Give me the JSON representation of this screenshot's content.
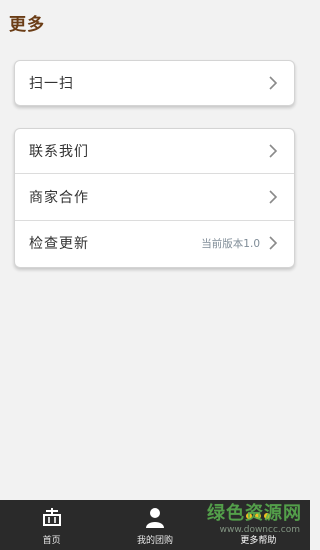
{
  "header": {
    "title": "更多"
  },
  "scan_card": {
    "label": "扫一扫"
  },
  "menu": {
    "items": [
      {
        "label": "联系我们"
      },
      {
        "label": "商家合作"
      },
      {
        "label": "检查更新",
        "value": "当前版本1.0"
      }
    ]
  },
  "tabbar": {
    "tabs": [
      {
        "label": "首页",
        "icon": "home-basket-icon"
      },
      {
        "label": "我的团购",
        "icon": "user-icon"
      },
      {
        "label": "更多帮助",
        "icon": "more-dots-icon",
        "active": true
      }
    ]
  },
  "watermark": {
    "text": "绿色资源网",
    "url": "www.downcc.com"
  },
  "colors": {
    "title": "#6b3d16",
    "tabbar": "#2a2a2a",
    "active_dots": "#f0c020"
  }
}
